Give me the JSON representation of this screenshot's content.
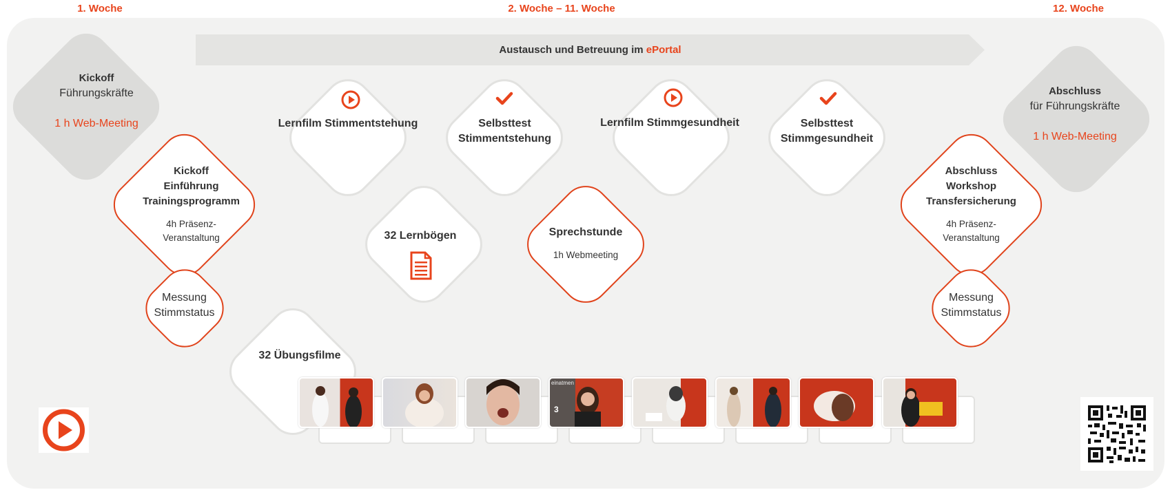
{
  "weeks": {
    "w1": "1. Woche",
    "w2_11": "2. Woche – 11. Woche",
    "w12": "12. Woche"
  },
  "banner": {
    "text": "Austausch und Betreuung im ",
    "highlight": "ePortal"
  },
  "kickoff_leaders": {
    "title": "Kickoff",
    "subtitle": "Führungskräfte",
    "meeting": "1 h Web-Meeting"
  },
  "kickoff_training": {
    "line1": "Kickoff",
    "line2": "Einführung",
    "line3": "Trainingsprogramm",
    "detail1": "4h Präsenz-",
    "detail2": "Veranstaltung"
  },
  "measurement_left": {
    "line1": "Messung",
    "line2": "Stimmstatus"
  },
  "lernfilm_entstehung": {
    "label": "Lernfilm Stimmentstehung",
    "icon": "play-icon"
  },
  "selbsttest_entstehung": {
    "line1": "Selbsttest",
    "line2": "Stimmentstehung",
    "icon": "check-icon"
  },
  "lernfilm_gesundheit": {
    "label": "Lernfilm Stimmgesundheit",
    "icon": "play-icon"
  },
  "selbsttest_gesundheit": {
    "line1": "Selbsttest",
    "line2": "Stimmgesundheit",
    "icon": "check-icon"
  },
  "lernboegen": {
    "label": "32 Lernbögen",
    "icon": "document-icon"
  },
  "sprechstunde": {
    "title": "Sprechstunde",
    "detail": "1h Webmeeting"
  },
  "uebungsfilme": {
    "label": "32 Übungsfilme",
    "thumb3_caption": "einatmen",
    "thumb3_number": "3"
  },
  "abschluss_leaders": {
    "title": "Abschluss",
    "subtitle": "für Führungskräfte",
    "meeting": "1 h Web-Meeting"
  },
  "abschluss_workshop": {
    "line1": "Abschluss",
    "line2": "Workshop",
    "line3": "Transfersicherung",
    "detail1": "4h Präsenz-",
    "detail2": "Veranstaltung"
  },
  "measurement_right": {
    "line1": "Messung",
    "line2": "Stimmstatus"
  },
  "colors": {
    "accent": "#e8441c",
    "panel": "#f2f2f1",
    "gray_diamond": "#dcdcda",
    "banner": "#e4e4e2"
  },
  "icons": {
    "logo": "play-logo-icon",
    "qr": "qr-code-icon"
  }
}
